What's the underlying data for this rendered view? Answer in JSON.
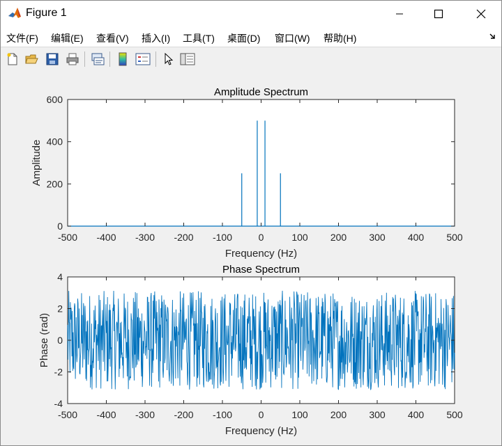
{
  "window": {
    "title": "Figure 1",
    "controls": {
      "minimize": "minimize",
      "maximize": "maximize",
      "close": "close"
    }
  },
  "menu": {
    "items": [
      "文件(F)",
      "编辑(E)",
      "查看(V)",
      "插入(I)",
      "工具(T)",
      "桌面(D)",
      "窗口(W)",
      "帮助(H)"
    ]
  },
  "toolbar": {
    "icons": [
      "new-figure-icon",
      "open-file-icon",
      "save-icon",
      "print-icon",
      "link-plot-icon",
      "colorbar-icon",
      "legend-icon",
      "pointer-icon",
      "property-inspector-icon"
    ]
  },
  "colors": {
    "line": "#0072bd",
    "axes_bg": "#ffffff",
    "figure_bg": "#f0f0f0"
  },
  "chart_data": [
    {
      "type": "line",
      "title": "Amplitude Spectrum",
      "xlabel": "Frequency (Hz)",
      "ylabel": "Amplitude",
      "xlim": [
        -500,
        500
      ],
      "ylim": [
        0,
        600
      ],
      "xticks": [
        -500,
        -400,
        -300,
        -200,
        -100,
        0,
        100,
        200,
        300,
        400,
        500
      ],
      "yticks": [
        0,
        200,
        400,
        600
      ],
      "grid": false,
      "baseline": 0,
      "peaks": [
        {
          "x": -50,
          "y": 250
        },
        {
          "x": -10,
          "y": 500
        },
        {
          "x": 10,
          "y": 500
        },
        {
          "x": 50,
          "y": 250
        }
      ]
    },
    {
      "type": "line",
      "title": "Phase Spectrum",
      "xlabel": "Frequency (Hz)",
      "ylabel": "Phase (rad)",
      "xlim": [
        -500,
        500
      ],
      "ylim": [
        -4,
        4
      ],
      "xticks": [
        -500,
        -400,
        -300,
        -200,
        -100,
        0,
        100,
        200,
        300,
        400,
        500
      ],
      "yticks": [
        -4,
        -2,
        0,
        2,
        4
      ],
      "grid": false,
      "range": [
        -3.14,
        3.14
      ]
    }
  ]
}
